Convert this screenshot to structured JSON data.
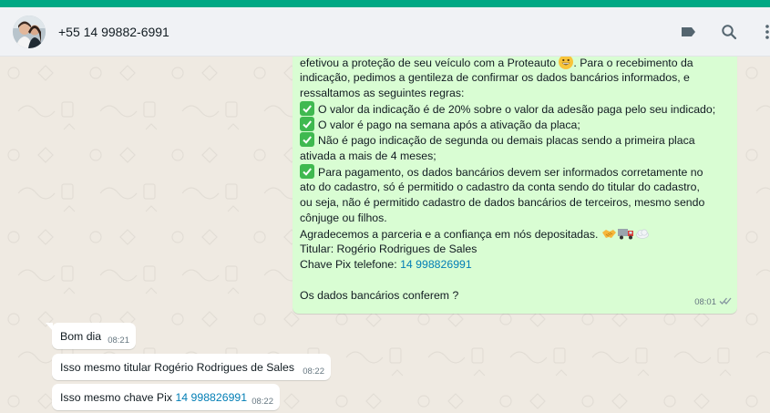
{
  "header": {
    "contact_name": "+55 14 99882-6991",
    "icons": [
      "label-icon",
      "search-icon",
      "menu-icon"
    ]
  },
  "colors": {
    "accent": "#00a884",
    "outgoing_bubble": "#d9fdd3",
    "incoming_bubble": "#ffffff",
    "chat_background": "#efeae2",
    "link": "#027eb5",
    "check_emoji": "#3fb950"
  },
  "outgoing": {
    "lines": [
      "efetivou a proteção de seu veículo com a Proteauto",
      ". Para o recebimento da",
      "indicação, pedimos a gentileza de confirmar os dados bancários informados, e",
      "ressaltamos as seguintes regras:",
      "O valor da indicação é de 20% sobre o valor da adesão paga pelo seu indicado;",
      "O valor é pago na semana após a ativação da placa;",
      "Não é pago indicação de segunda ou demais placas sendo a primeira placa",
      "ativada a mais de 4 meses;",
      "Para pagamento, os dados bancários devem ser informados corretamente no",
      "ato do cadastro, só é permitido o cadastro da conta sendo do titular do cadastro,",
      "ou seja, não é permitido cadastro de dados bancários de terceiros, mesmo sendo",
      "cônjuge ou filhos.",
      "Agradecemos a parceria e a confiança em nós depositadas.",
      "Titular: Rogério Rodrigues de Sales",
      "Chave Pix telefone:",
      "14 998826991",
      "Os dados bancários conferem ?"
    ],
    "time": "08:01"
  },
  "incoming": [
    {
      "text": "Bom dia",
      "time": "08:21"
    },
    {
      "text": "Isso mesmo titular Rogério Rodrigues de Sales",
      "time": "08:22"
    },
    {
      "text": "Isso mesmo chave Pix",
      "link": "14 998826991",
      "time": "08:22"
    }
  ]
}
